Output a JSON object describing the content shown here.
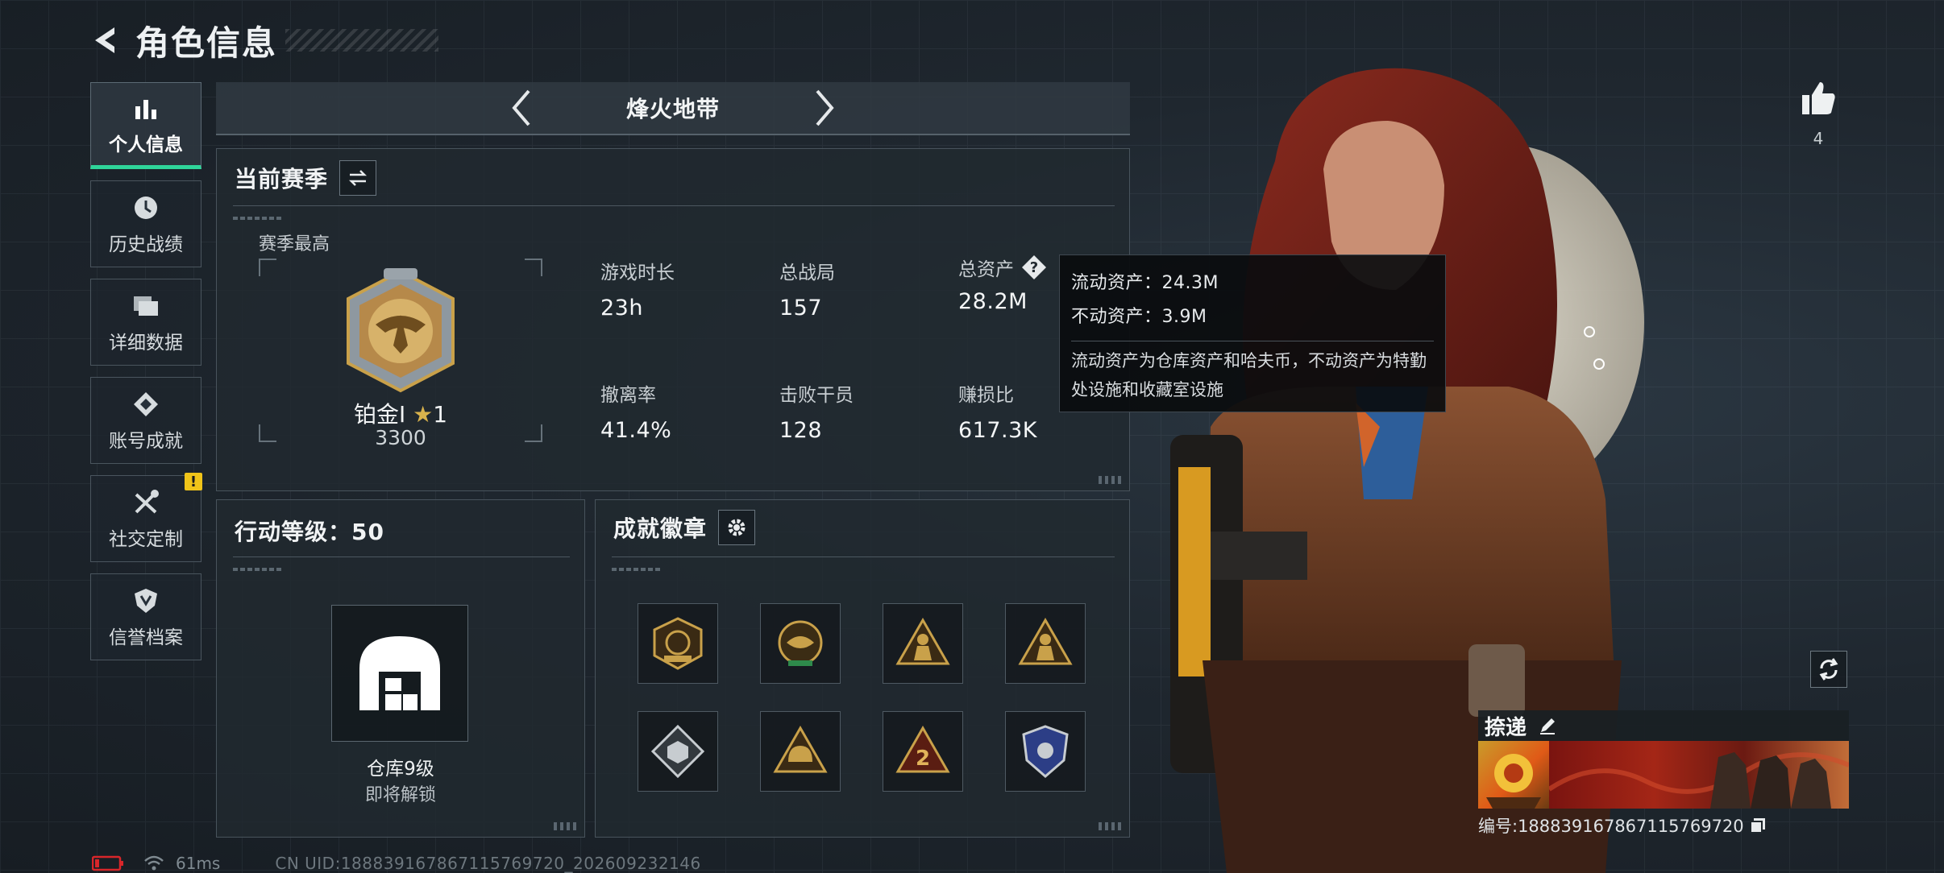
{
  "header": {
    "title": "角色信息"
  },
  "sidebar": {
    "items": [
      {
        "label": "个人信息",
        "icon": "bar-chart-icon",
        "active": true
      },
      {
        "label": "历史战绩",
        "icon": "clock-icon",
        "active": false
      },
      {
        "label": "详细数据",
        "icon": "folder-icon",
        "active": false
      },
      {
        "label": "账号成就",
        "icon": "achievement-icon",
        "active": false
      },
      {
        "label": "社交定制",
        "icon": "tools-icon",
        "active": false,
        "badge": "!"
      },
      {
        "label": "信誉档案",
        "icon": "shield-icon",
        "active": false
      }
    ]
  },
  "mode": {
    "name": "烽火地带"
  },
  "season": {
    "title": "当前赛季",
    "best_label": "赛季最高",
    "rank_name": "铂金Ⅰ",
    "rank_star": "★",
    "rank_stars": "1",
    "rank_points": "3300",
    "stats": [
      {
        "label": "游戏时长",
        "value": "23h"
      },
      {
        "label": "总战局",
        "value": "157"
      },
      {
        "label": "总资产",
        "value": "28.2M"
      },
      {
        "label": "撤离率",
        "value": "41.4%"
      },
      {
        "label": "击败干员",
        "value": "128"
      },
      {
        "label": "赚损比",
        "value": "617.3K"
      }
    ]
  },
  "tooltip": {
    "liquid": "流动资产：24.3M",
    "fixed": "不动资产：3.9M",
    "note": "流动资产为仓库资产和哈夫币，不动资产为特勤处设施和收藏室设施"
  },
  "level": {
    "title": "行动等级：50",
    "warehouse_name": "仓库9级",
    "warehouse_sub": "即将解锁"
  },
  "achievements": {
    "title": "成就徽章",
    "badges": [
      "season-badge-icon",
      "emblem-badge-icon",
      "soldier-triangle-icon",
      "soldier-triangle-icon",
      "cube-diamond-icon",
      "helmet-triangle-icon",
      "number-two-triangle-icon",
      "police-shield-icon"
    ],
    "badge_two_text": "2"
  },
  "profile": {
    "likes": "4",
    "name": "捺递",
    "id": "编号:1888391678671157697​20"
  },
  "status": {
    "ping": "61ms",
    "uid": "CN UID:1888391678671157697​20_202609232146"
  },
  "colors": {
    "accent_green": "#2fd59a",
    "badge_gold": "#c9a14a",
    "warning_yellow": "#f0c419",
    "battery_red": "#d8262a"
  }
}
